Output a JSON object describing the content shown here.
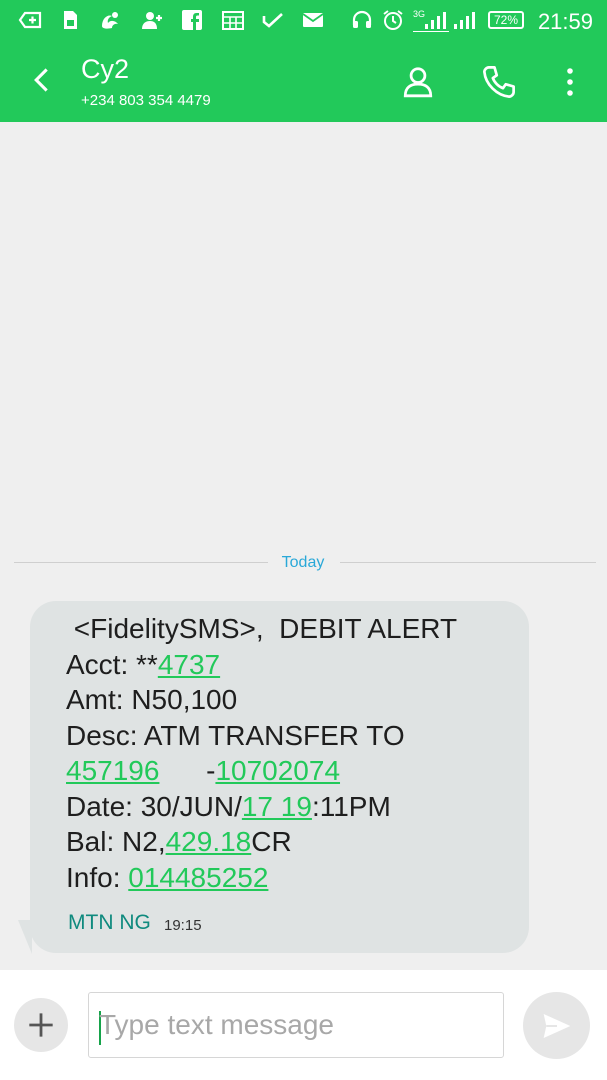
{
  "status_bar": {
    "time": "21:59",
    "battery": "72%",
    "network": "3G",
    "icons": [
      "screenshot-icon",
      "sim-icon",
      "uc-browser-icon",
      "add-contact-icon",
      "facebook-icon",
      "calendar-icon",
      "check-icon",
      "email-icon",
      "headphones-icon",
      "alarm-icon",
      "signal-3g-icon",
      "signal-icon",
      "battery-icon"
    ]
  },
  "header": {
    "contact_name": "Cy2",
    "contact_number": "+234 803 354 4479"
  },
  "thread": {
    "date_divider": "Today",
    "message": {
      "text_lines": [
        [
          {
            "t": " <FidelitySMS>,  DEBIT ALERT"
          }
        ],
        [
          {
            "t": "Acct: **"
          },
          {
            "t": "4737",
            "link": true
          }
        ],
        [
          {
            "t": "Amt: N50,100"
          }
        ],
        [
          {
            "t": "Desc: ATM TRANSFER TO"
          }
        ],
        [
          {
            "t": "457196",
            "link": true
          },
          {
            "t": "      -"
          },
          {
            "t": "10702074",
            "link": true
          }
        ],
        [
          {
            "t": "Date: 30/JUN/"
          },
          {
            "t": "17 19",
            "link": true
          },
          {
            "t": ":11PM"
          }
        ],
        [
          {
            "t": "Bal: N2,"
          },
          {
            "t": "429.18",
            "link": true
          },
          {
            "t": "CR"
          }
        ],
        [
          {
            "t": "Info: "
          },
          {
            "t": "014485252",
            "link": true
          }
        ]
      ],
      "sender": "MTN NG",
      "time": "19:15"
    }
  },
  "composer": {
    "placeholder": "Type text message"
  },
  "colors": {
    "accent": "#22c95a",
    "bubble": "#dfe3e3",
    "link": "#22c95a",
    "sender": "#0f8a7e",
    "divider_label": "#29a8d8"
  }
}
